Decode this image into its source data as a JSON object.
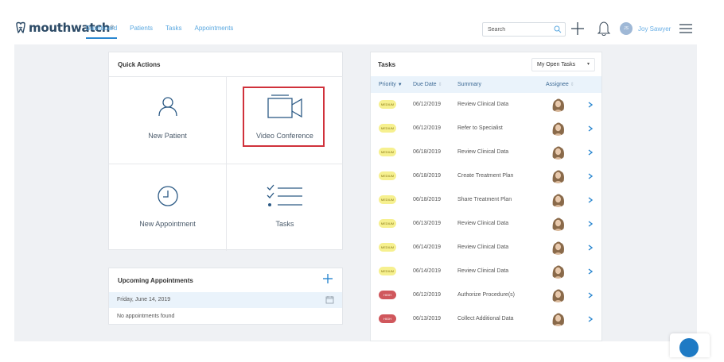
{
  "brand": {
    "name": "mouthwatch",
    "reg": "®"
  },
  "nav": [
    {
      "label": "Dashboard",
      "active": true
    },
    {
      "label": "Patients",
      "active": false
    },
    {
      "label": "Tasks",
      "active": false
    },
    {
      "label": "Appointments",
      "active": false
    }
  ],
  "search": {
    "placeholder": "Search"
  },
  "user": {
    "initials": "JS",
    "name": "Joy Sawyer"
  },
  "quick_actions": {
    "title": "Quick Actions",
    "tiles": [
      {
        "label": "New Patient",
        "icon": "person-icon"
      },
      {
        "label": "Video Conference",
        "icon": "video-camera-icon"
      },
      {
        "label": "New Appointment",
        "icon": "clock-icon"
      },
      {
        "label": "Tasks",
        "icon": "checklist-icon"
      }
    ]
  },
  "upcoming": {
    "title": "Upcoming Appointments",
    "date": "Friday, June 14, 2019",
    "empty": "No appointments found"
  },
  "tasks": {
    "title": "Tasks",
    "filter": "My Open Tasks",
    "columns": {
      "priority": "Priority",
      "due": "Due Date",
      "summary": "Summary",
      "assignee": "Assignee"
    },
    "rows": [
      {
        "priority": "MEDIUM",
        "due": "06/12/2019",
        "summary": "Review Clinical Data"
      },
      {
        "priority": "MEDIUM",
        "due": "06/12/2019",
        "summary": "Refer to Specialist"
      },
      {
        "priority": "MEDIUM",
        "due": "06/18/2019",
        "summary": "Review Clinical Data"
      },
      {
        "priority": "MEDIUM",
        "due": "06/18/2019",
        "summary": "Create Treatment Plan"
      },
      {
        "priority": "MEDIUM",
        "due": "06/18/2019",
        "summary": "Share Treatment Plan"
      },
      {
        "priority": "MEDIUM",
        "due": "06/13/2019",
        "summary": "Review Clinical Data"
      },
      {
        "priority": "MEDIUM",
        "due": "06/14/2019",
        "summary": "Review Clinical Data"
      },
      {
        "priority": "MEDIUM",
        "due": "06/14/2019",
        "summary": "Review Clinical Data"
      },
      {
        "priority": "HIGH",
        "due": "06/12/2019",
        "summary": "Authorize Procedure(s)"
      },
      {
        "priority": "HIGH",
        "due": "06/13/2019",
        "summary": "Collect Additional Data"
      }
    ]
  },
  "colors": {
    "accent": "#2a87d0",
    "nav_text": "#5aa8e0",
    "medium_badge": "#f6f08f",
    "high_badge": "#d0575c",
    "highlight": "#d0313b"
  }
}
